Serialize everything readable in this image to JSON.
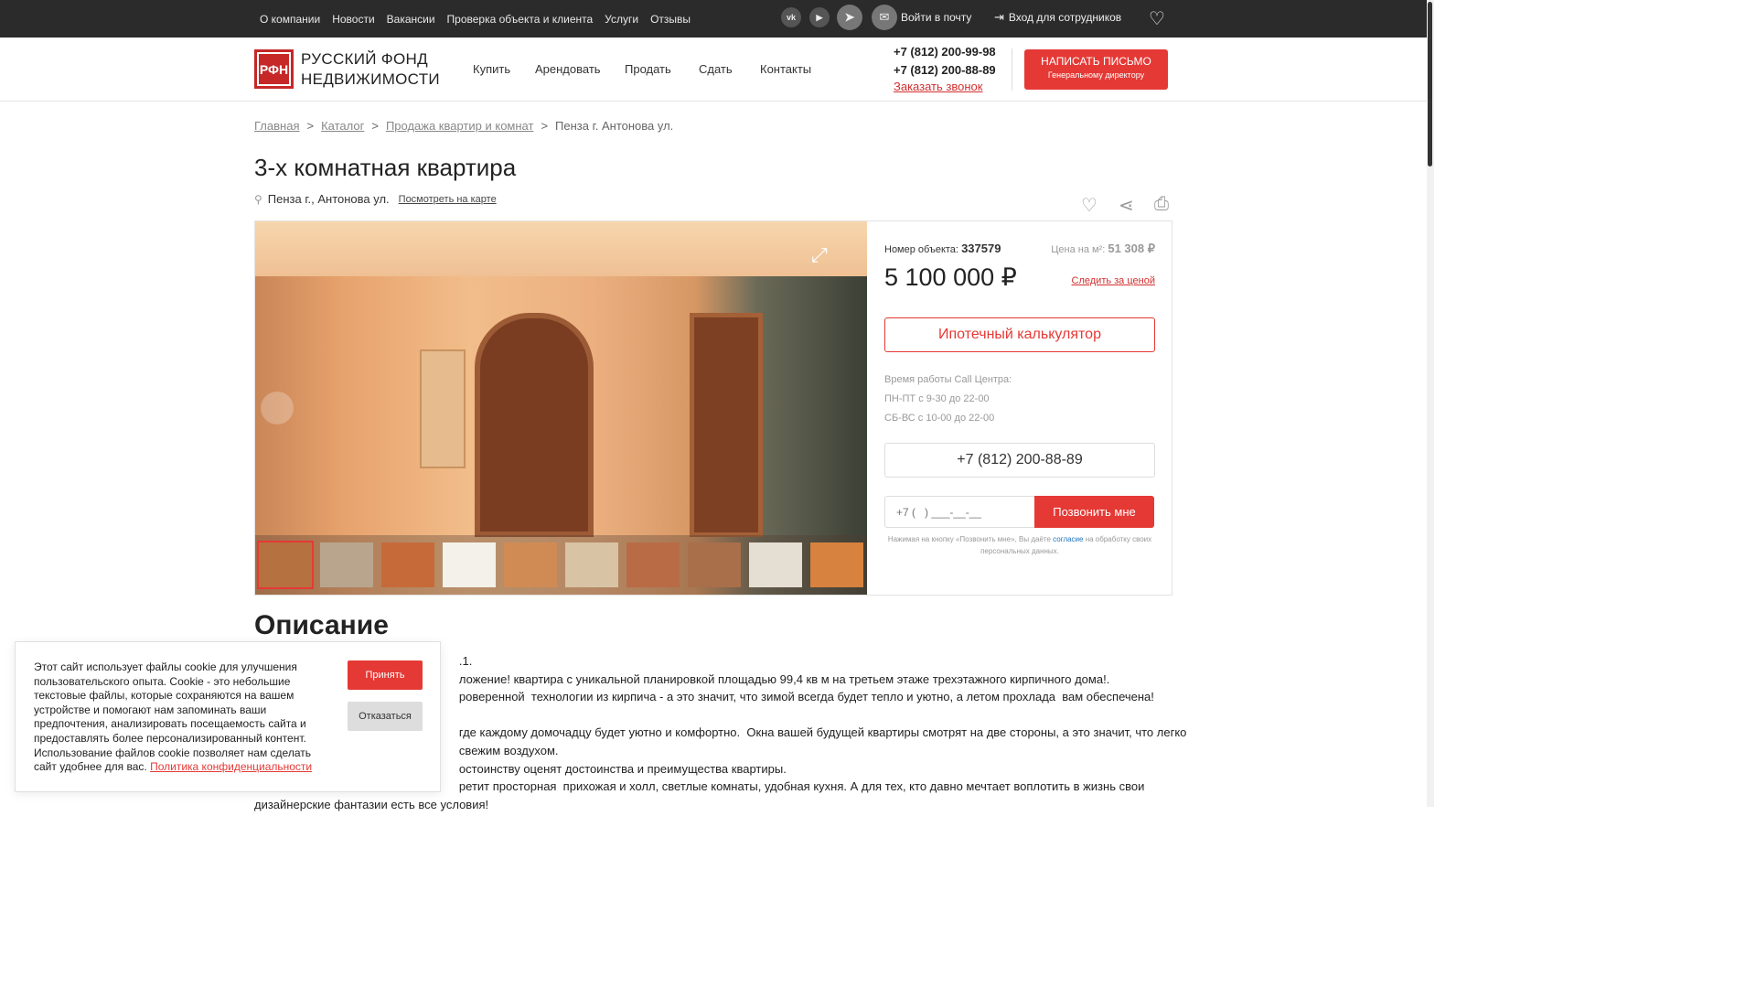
{
  "topbar": {
    "nav": [
      "О компании",
      "Новости",
      "Вакансии",
      "Проверка объекта и клиента",
      "Услуги",
      "Отзывы"
    ],
    "mail_login": "Войти в почту",
    "staff_login": "Вход для сотрудников"
  },
  "header": {
    "logo_line1": "РУССКИЙ ФОНД",
    "logo_line2": "НЕДВИЖИМОСТИ",
    "logo_mark": "РФН",
    "nav": [
      "Купить",
      "Арендовать",
      "Продать",
      "Сдать",
      "Контакты"
    ],
    "phone1": "+7 (812) 200-99-98",
    "phone2": "+7 (812) 200-88-89",
    "callback": "Заказать звонок",
    "write_btn": "НАПИСАТЬ ПИСЬМО",
    "write_sub": "Генеральному директору"
  },
  "breadcrumb": {
    "items": [
      "Главная",
      "Каталог",
      "Продажа квартир и комнат"
    ],
    "current": "Пенза г. Антонова ул."
  },
  "listing": {
    "title": "3-х комнатная квартира",
    "address": "Пенза г., Антонова ул.",
    "map_link": "Посмотреть на карте",
    "object_label": "Номер объекта:",
    "object_number": "337579",
    "ppm_label": "Цена на м²:",
    "ppm_value": "51 308 ₽",
    "price": "5 100 000 ₽",
    "watch_price": "Следить за ценой",
    "mortgage_btn": "Ипотечный калькулятор",
    "hours_title": "Время работы Call Центра:",
    "hours_weekdays": "ПН-ПТ с 9-30 до 22-00",
    "hours_weekend": "СБ-ВС с 10-00 до 22-00",
    "cc_phone": "+7 (812) 200-88-89",
    "phone_placeholder": "+7 (   ) ___-__-__",
    "call_me": "Позвонить мне",
    "consent_pre": "Нажимая на кнопку «Позвонить мне», Вы даёте",
    "consent_link": "согласие",
    "consent_post": "на обработку своих персональных данных."
  },
  "description": {
    "title": "Описание",
    "lines": [
      "                                                              .1.",
      "                                                              ложение! квартира с уникальной планировкой площадью 99,4 кв м на третьем этаже трехэтажного кирпичного дома!.",
      "                                                              роверенной  технологии из кирпича - а это значит, что зимой всегда будет тепло и уютно, а летом прохлада  вам обеспечена!",
      "",
      "                                                              где каждому домочадцу будет уютно и комфортно.  Окна вашей будущей квартиры смотрят на две стороны, а это значит, что легко",
      "                                                              свежим воздухом.",
      "                                                              остоинству оценят достоинства и преимущества квартиры.",
      "                                                              ретит просторная  прихожая и холл, светлые комнаты, удобная кухня. А для тех, кто давно мечтает воплотить в жизнь свои",
      "дизайнерские фантазии есть все условия!"
    ]
  },
  "cookie": {
    "text": "Этот сайт использует файлы cookie для улучшения пользовательского опыта. Cookie - это небольшие текстовые файлы, которые сохраняются на вашем устройстве и помогают нам запоминать ваши предпочтения, анализировать посещаемость сайта и предоставлять более персонализированный контент. Использование файлов cookie позволяет нам сделать сайт удобнее для вас.",
    "policy": "Политика конфиденциальности",
    "accept": "Принять",
    "decline": "Отказаться"
  },
  "colors": {
    "accent": "#e53935",
    "topbar": "#2b2b2b"
  }
}
